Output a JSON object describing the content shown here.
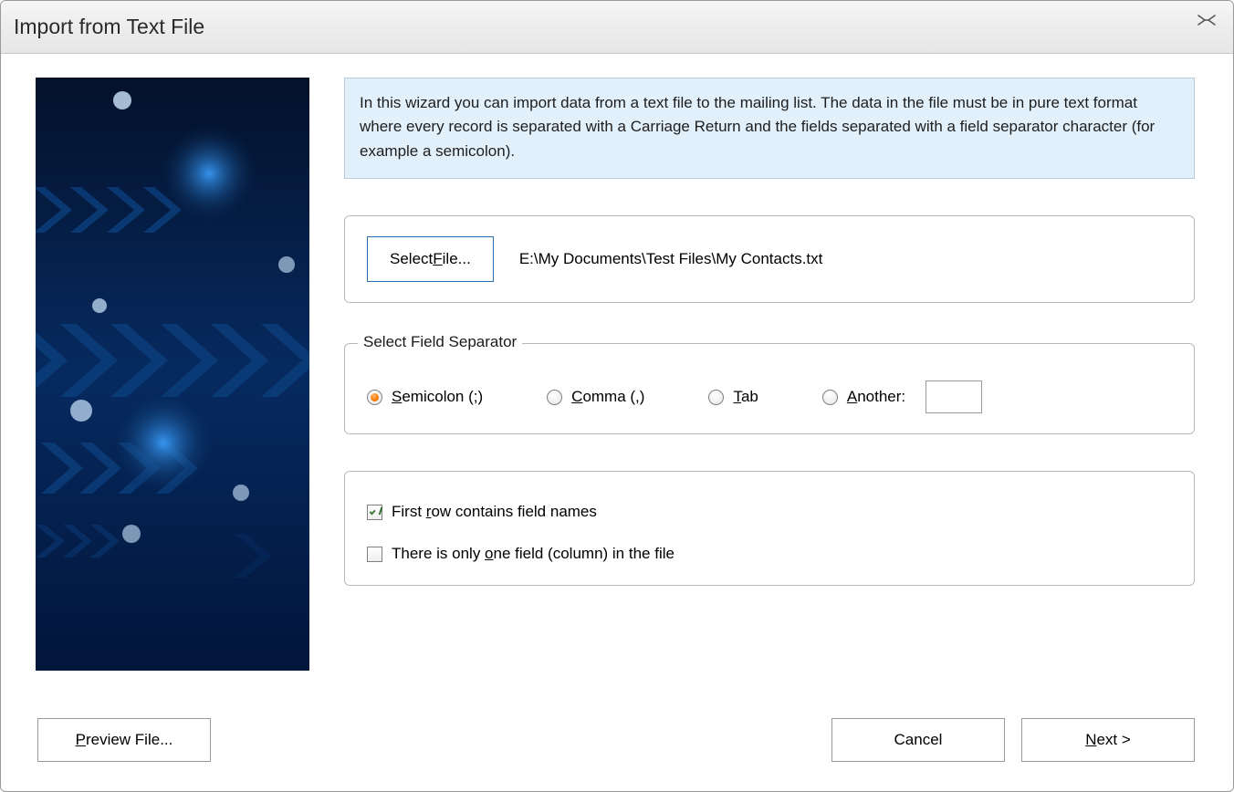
{
  "window": {
    "title": "Import from Text File"
  },
  "info": {
    "text": "In this wizard you can import data from a text file to the mailing list. The data in the file must be in pure text format where every record is separated with a Carriage Return and the fields separated with a field separator character (for example a semicolon)."
  },
  "file": {
    "select_button_pre": "Select ",
    "select_button_accel": "F",
    "select_button_post": "ile...",
    "path": "E:\\My Documents\\Test Files\\My Contacts.txt"
  },
  "separator": {
    "legend": "Select Field Separator",
    "semicolon_accel": "S",
    "semicolon_post": "emicolon (;)",
    "comma_accel": "C",
    "comma_post": "omma (,)",
    "tab_accel": "T",
    "tab_post": "ab",
    "another_accel": "A",
    "another_post": "nother:",
    "custom_value": "",
    "selected": "semicolon"
  },
  "options": {
    "first_row_pre": "First ",
    "first_row_accel": "r",
    "first_row_post": "ow contains field names",
    "first_row_checked": true,
    "one_field_pre": "There is only ",
    "one_field_accel": "o",
    "one_field_post": "ne field (column) in the file",
    "one_field_checked": false
  },
  "buttons": {
    "preview_accel": "P",
    "preview_post": "review File...",
    "cancel": "Cancel",
    "next_accel": "N",
    "next_post": "ext >"
  }
}
